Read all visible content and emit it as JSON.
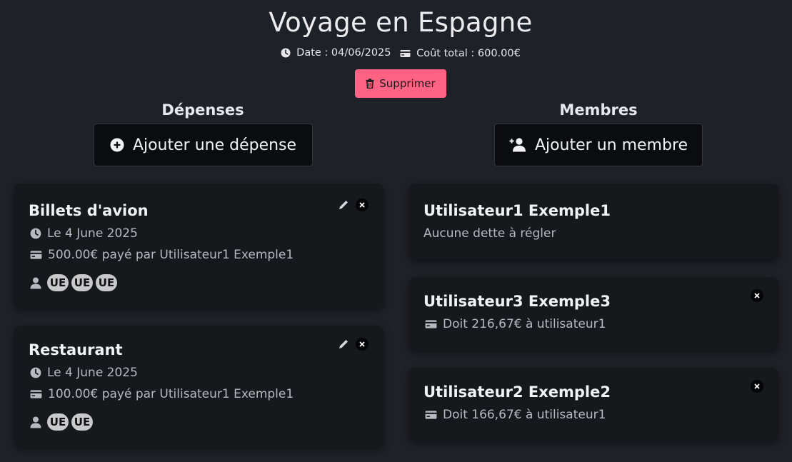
{
  "header": {
    "title": "Voyage en Espagne",
    "date_text": "Date : 04/06/2025",
    "total_text": "Coût total : 600.00€",
    "delete_label": "Supprimer"
  },
  "expenses": {
    "title": "Dépenses",
    "add_label": "Ajouter une dépense",
    "items": [
      {
        "name": "Billets d'avion",
        "date": "Le 4 June 2025",
        "amount": "500.00€ payé par Utilisateur1 Exemple1",
        "avatars": [
          "UE",
          "UE",
          "UE"
        ]
      },
      {
        "name": "Restaurant",
        "date": "Le 4 June 2025",
        "amount": "100.00€ payé par Utilisateur1 Exemple1",
        "avatars": [
          "UE",
          "UE"
        ]
      }
    ]
  },
  "members": {
    "title": "Membres",
    "add_label": "Ajouter un membre",
    "items": [
      {
        "name": "Utilisateur1 Exemple1",
        "status": "Aucune dette à régler"
      },
      {
        "name": "Utilisateur3 Exemple3",
        "status": "Doit 216,67€ à utilisateur1"
      },
      {
        "name": "Utilisateur2 Exemple2",
        "status": "Doit 166,67€ à utilisateur1"
      }
    ]
  },
  "colors": {
    "background": "#1f2128",
    "card": "#17181c",
    "delete_button": "#ff6384",
    "avatar": "#c9c9cc"
  },
  "icons": {
    "date": "clock-icon",
    "total": "credit-card-icon",
    "delete": "trash-icon",
    "add_expense": "plus-circle-icon",
    "add_member": "user-plus-icon",
    "edit": "pencil-icon",
    "remove": "close-icon",
    "participants": "person-icon"
  }
}
